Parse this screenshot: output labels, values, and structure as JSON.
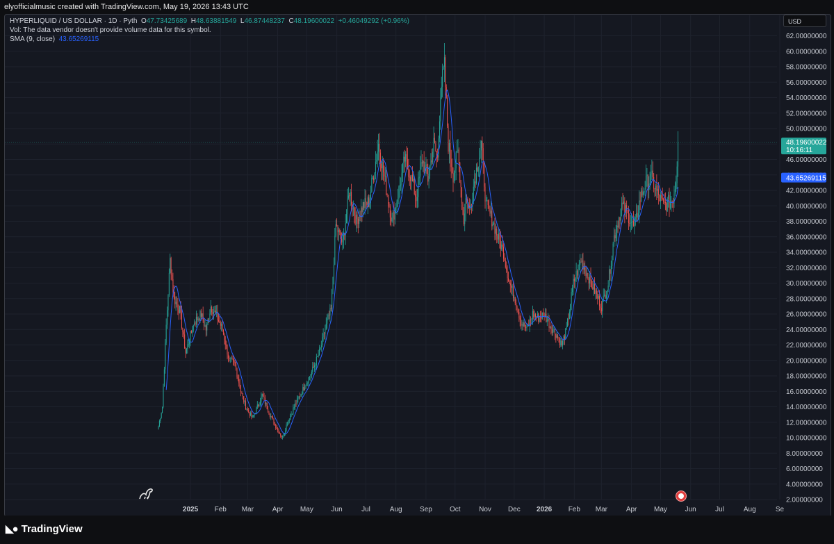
{
  "header": {
    "credit": "elyofficialmusic created with TradingView.com, May 19, 2026 13:43 UTC"
  },
  "legend": {
    "symbol": "HYPERLIQUID / US DOLLAR · 1D · Pyth",
    "o_label": "O",
    "o_value": "47.73425689",
    "h_label": "H",
    "h_value": "48.63881549",
    "l_label": "L",
    "l_value": "46.87448237",
    "c_label": "C",
    "c_value": "48.19600022",
    "change": "+0.46049292 (+0.96%)",
    "vol_note": "Vol: The data vendor doesn't provide volume data for this symbol.",
    "sma_label": "SMA (9, close)",
    "sma_value": "43.65269115"
  },
  "currency": "USD",
  "footer": {
    "brand": "TradingView"
  },
  "colors": {
    "up": "#26a69a",
    "down": "#ef5350",
    "sma": "#2962ff",
    "grid": "#1e222d",
    "bg": "#151821"
  },
  "icons": {
    "logo": "tradingview-logo-icon",
    "dino": "dino-icon",
    "flag": "us-flag-icon"
  },
  "chart_data": {
    "type": "candlestick",
    "title": "HYPERLIQUID / US DOLLAR · 1D · Pyth",
    "ylim": [
      2,
      62
    ],
    "y_ticks": [
      "2.00000000",
      "4.00000000",
      "6.00000000",
      "8.00000000",
      "10.00000000",
      "12.00000000",
      "14.00000000",
      "16.00000000",
      "18.00000000",
      "20.00000000",
      "22.00000000",
      "24.00000000",
      "26.00000000",
      "28.00000000",
      "30.00000000",
      "32.00000000",
      "34.00000000",
      "36.00000000",
      "38.00000000",
      "40.00000000",
      "42.00000000",
      "44.00000000",
      "46.00000000",
      "48.00000000",
      "50.00000000",
      "52.00000000",
      "54.00000000",
      "56.00000000",
      "58.00000000",
      "60.00000000",
      "62.00000000"
    ],
    "x_ticks": [
      "2025",
      "Feb",
      "Mar",
      "Apr",
      "May",
      "Jun",
      "Jul",
      "Aug",
      "Sep",
      "Oct",
      "Nov",
      "Dec",
      "2026",
      "Feb",
      "Mar",
      "Apr",
      "May",
      "Jun",
      "Jul",
      "Aug",
      "Se"
    ],
    "x_range": [
      "2024-11-29",
      "2026-09-01"
    ],
    "price_close_series": {
      "dates": [
        "2024-11-29",
        "2024-12-03",
        "2024-12-07",
        "2024-12-11",
        "2024-12-15",
        "2024-12-21",
        "2024-12-27",
        "2025-01-05",
        "2025-01-12",
        "2025-01-17",
        "2025-01-22",
        "2025-01-27",
        "2025-02-03",
        "2025-02-10",
        "2025-02-16",
        "2025-02-22",
        "2025-02-27",
        "2025-03-06",
        "2025-03-11",
        "2025-03-16",
        "2025-03-24",
        "2025-04-01",
        "2025-04-06",
        "2025-04-11",
        "2025-04-18",
        "2025-04-28",
        "2025-05-06",
        "2025-05-14",
        "2025-05-22",
        "2025-05-26",
        "2025-05-31",
        "2025-06-07",
        "2025-06-14",
        "2025-06-21",
        "2025-06-28",
        "2025-07-04",
        "2025-07-10",
        "2025-07-14",
        "2025-07-21",
        "2025-07-28",
        "2025-08-04",
        "2025-08-10",
        "2025-08-16",
        "2025-08-22",
        "2025-08-28",
        "2025-09-03",
        "2025-09-09",
        "2025-09-13",
        "2025-09-16",
        "2025-09-20",
        "2025-09-24",
        "2025-09-29",
        "2025-10-04",
        "2025-10-10",
        "2025-10-12",
        "2025-10-16",
        "2025-10-22",
        "2025-10-28",
        "2025-11-02",
        "2025-11-09",
        "2025-11-14",
        "2025-11-20",
        "2025-11-26",
        "2025-12-02",
        "2025-12-08",
        "2025-12-14",
        "2025-12-20",
        "2025-12-26",
        "2026-01-01",
        "2026-01-07",
        "2026-01-13",
        "2026-01-19",
        "2026-01-24",
        "2026-01-31",
        "2026-02-08",
        "2026-02-15",
        "2026-02-22",
        "2026-03-01",
        "2026-03-08",
        "2026-03-14",
        "2026-03-22",
        "2026-03-28",
        "2026-04-04",
        "2026-04-10",
        "2026-04-16",
        "2026-04-22",
        "2026-04-28",
        "2026-05-04",
        "2026-05-10",
        "2026-05-14",
        "2026-05-17",
        "2026-05-19"
      ],
      "close": [
        11.5,
        14.0,
        24.5,
        33.0,
        28.0,
        26.5,
        21.0,
        25.0,
        26.0,
        24.0,
        27.0,
        26.0,
        24.0,
        20.0,
        19.5,
        16.0,
        14.0,
        12.5,
        14.0,
        15.5,
        13.0,
        11.0,
        10.0,
        12.0,
        14.0,
        16.5,
        18.5,
        21.0,
        25.0,
        26.5,
        37.5,
        35.0,
        42.0,
        38.0,
        40.0,
        40.5,
        45.0,
        48.0,
        43.0,
        38.0,
        42.0,
        46.0,
        44.0,
        41.0,
        46.0,
        43.5,
        48.0,
        46.0,
        55.0,
        58.0,
        48.0,
        44.0,
        47.0,
        38.0,
        41.0,
        39.5,
        44.0,
        48.0,
        40.0,
        38.0,
        36.0,
        34.0,
        30.0,
        28.0,
        25.0,
        24.0,
        26.0,
        25.5,
        26.0,
        24.5,
        23.5,
        22.0,
        24.0,
        30.0,
        33.0,
        31.0,
        29.0,
        27.0,
        30.0,
        36.0,
        40.0,
        39.0,
        37.0,
        41.0,
        43.0,
        43.5,
        41.5,
        40.0,
        40.5,
        41.0,
        43.5,
        48.2
      ]
    },
    "sma": {
      "name": "SMA (9, close)",
      "last": 43.65269115
    },
    "last_price": {
      "value": 48.19600022,
      "label": "48.19600022",
      "countdown": "10:16:11"
    },
    "sma_label": "43.65269115",
    "grid": true,
    "legend_position": "top-left"
  }
}
